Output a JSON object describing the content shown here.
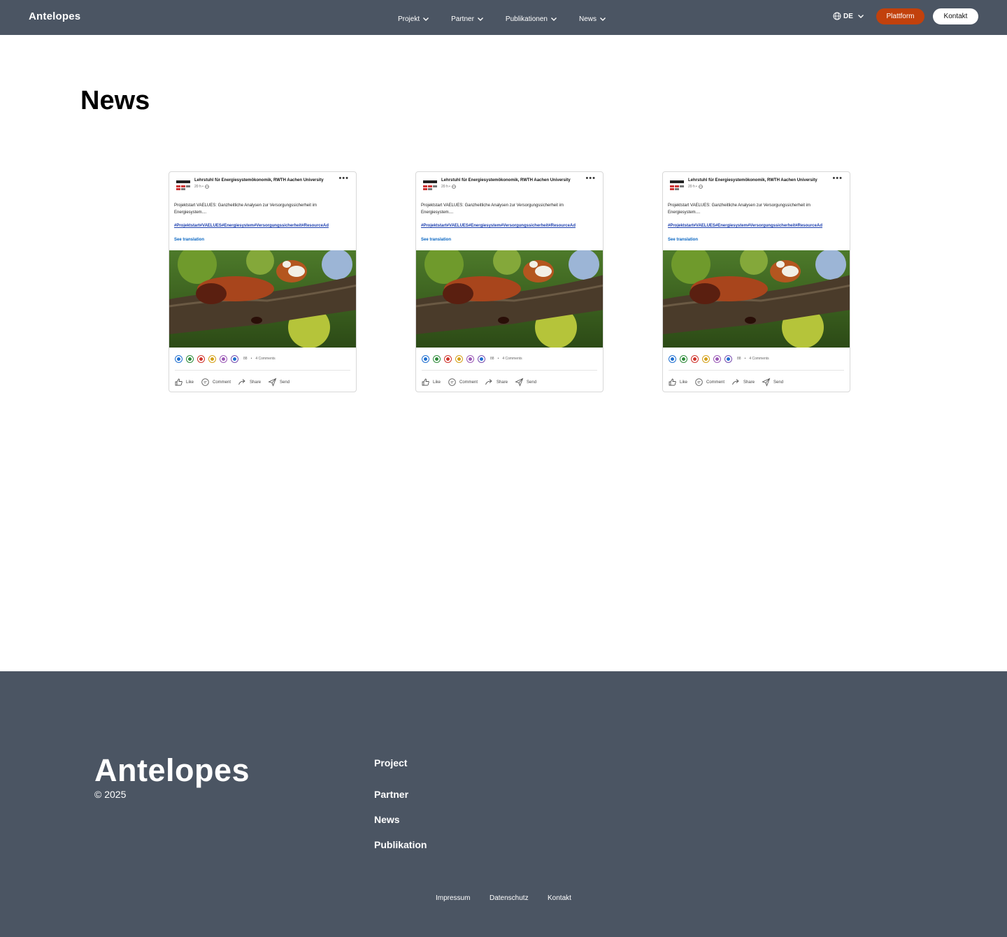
{
  "header": {
    "brand": "Antelopes",
    "nav": [
      {
        "label": "Projekt"
      },
      {
        "label": "Partner"
      },
      {
        "label": "Publikationen"
      },
      {
        "label": "News"
      }
    ],
    "language": "DE",
    "platform_button": "Plattform",
    "contact_button": "Kontakt"
  },
  "page": {
    "title": "News"
  },
  "posts": [
    {
      "author": "Lehrstuhl für Energiesystemökonomik, RWTH Aachen University",
      "time": "20 h •",
      "text": "Projektstart VAELUES: Ganzheitliche Analysen zur Versorgungssicherheit im Energiesystem....",
      "hashtags": "#Projektstart#VAELUES#Energiesystem#Versorgungssicherheit#ResourceAd",
      "see_translation": "See translation",
      "reaction_count": "88",
      "comments": "4 Comments",
      "actions": {
        "like": "Like",
        "comment": "Comment",
        "share": "Share",
        "send": "Send"
      }
    },
    {
      "author": "Lehrstuhl für Energiesystemökonomik, RWTH Aachen University",
      "time": "20 h •",
      "text": "Projektstart VAELUES: Ganzheitliche Analysen zur Versorgungssicherheit im Energiesystem....",
      "hashtags": "#Projektstart#VAELUES#Energiesystem#Versorgungssicherheit#ResourceAd",
      "see_translation": "See translation",
      "reaction_count": "88",
      "comments": "4 Comments",
      "actions": {
        "like": "Like",
        "comment": "Comment",
        "share": "Share",
        "send": "Send"
      }
    },
    {
      "author": "Lehrstuhl für Energiesystemökonomik, RWTH Aachen University",
      "time": "20 h •",
      "text": "Projektstart VAELUES: Ganzheitliche Analysen zur Versorgungssicherheit im Energiesystem....",
      "hashtags": "#Projektstart#VAELUES#Energiesystem#Versorgungssicherheit#ResourceAd",
      "see_translation": "See translation",
      "reaction_count": "88",
      "comments": "4 Comments",
      "actions": {
        "like": "Like",
        "comment": "Comment",
        "share": "Share",
        "send": "Send"
      }
    }
  ],
  "footer": {
    "brand": "Antelopes",
    "copyright": "© 2025",
    "links": [
      "Project",
      "Partner",
      "News",
      "Publikation"
    ],
    "legal": [
      "Impressum",
      "Datenschutz",
      "Kontakt"
    ]
  },
  "colors": {
    "header_bg": "#4b5563",
    "accent": "#c2410c",
    "link_blue": "#0a66c2"
  },
  "icons": [
    "chevron-down-icon",
    "globe-icon",
    "more-icon",
    "like-icon",
    "comment-icon",
    "share-icon",
    "send-icon",
    "reaction-icon"
  ]
}
